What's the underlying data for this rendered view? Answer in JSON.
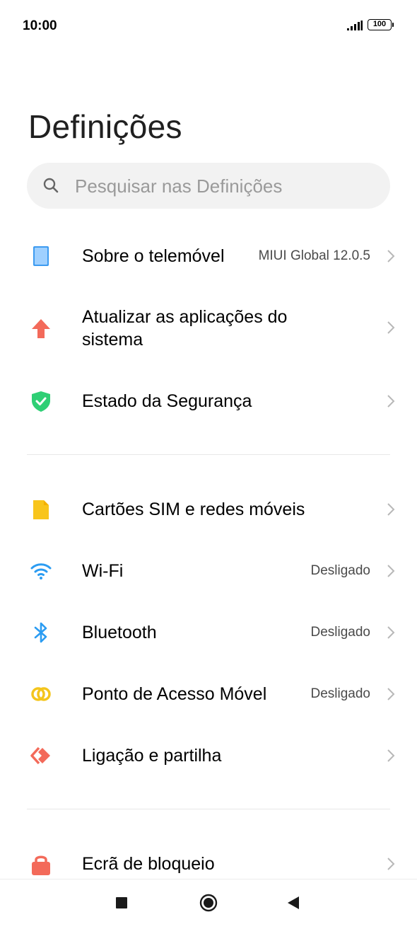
{
  "status_bar": {
    "time": "10:00",
    "battery": "100",
    "signal_icon": "signal-strength-icon"
  },
  "header": {
    "title": "Definições"
  },
  "search": {
    "placeholder": "Pesquisar nas Definições",
    "icon": "search-icon"
  },
  "items": [
    {
      "label": "Sobre o telemóvel",
      "value": "MIUI Global 12.0.5",
      "icon": "phone-icon",
      "color": "#3d9bf0"
    },
    {
      "label": "Atualizar as aplicações do",
      "label2": "sistema",
      "value": "",
      "icon": "update-arrow-icon",
      "color": "#f36a5a"
    },
    {
      "label": "Estado da Segurança",
      "value": "",
      "icon": "shield-check-icon",
      "color": "#2fcf75"
    },
    {
      "label": "Cartões SIM e redes móveis",
      "value": "",
      "icon": "sim-card-icon",
      "color": "#f8c51c"
    },
    {
      "label": "Wi-Fi",
      "value": "Desligado",
      "icon": "wifi-icon",
      "color": "#2b9cf2"
    },
    {
      "label": "Bluetooth",
      "value": "Desligado",
      "icon": "bluetooth-icon",
      "color": "#2b9cf2"
    },
    {
      "label": "Ponto de Acesso Móvel",
      "value": "Desligado",
      "icon": "hotspot-icon",
      "color": "#f4c51c"
    },
    {
      "label": "Ligação e partilha",
      "value": "",
      "icon": "connection-sharing-icon",
      "color": "#f36a5a"
    },
    {
      "label": "Ecrã de bloqueio",
      "value": "",
      "icon": "lock-icon",
      "color": "#f36a5a"
    }
  ],
  "navbar": {
    "recents_icon": "recents-square-icon",
    "home_icon": "home-circle-icon",
    "back_icon": "back-triangle-icon"
  }
}
